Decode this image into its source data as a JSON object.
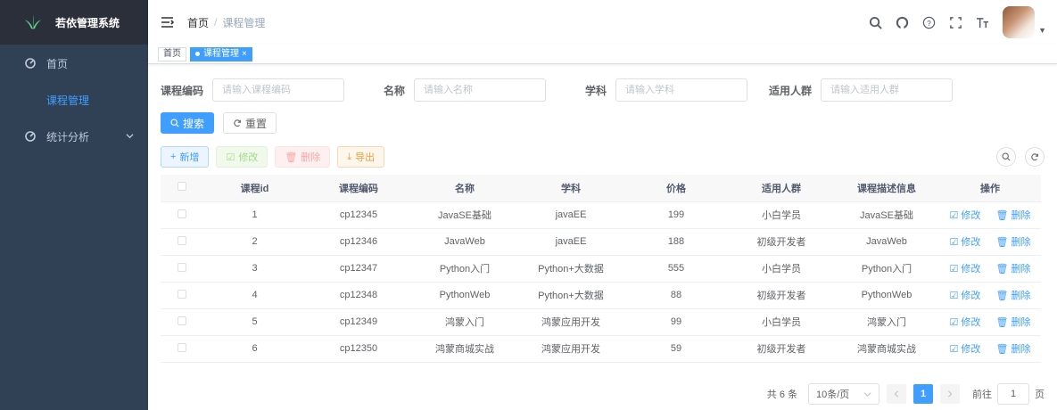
{
  "app": {
    "title": "若依管理系统"
  },
  "colors": {
    "sidebar_bg": "#304156",
    "primary": "#409eff",
    "active_menu": "#409eff"
  },
  "sidebar": {
    "items": [
      {
        "label": "首页",
        "icon": "dashboard-icon"
      },
      {
        "label": "课程管理",
        "active": true
      },
      {
        "label": "统计分析",
        "icon": "dashboard-icon",
        "expandable": true
      }
    ]
  },
  "navbar": {
    "breadcrumb": {
      "home": "首页",
      "separator": "/",
      "current": "课程管理"
    },
    "icons": [
      "search-icon",
      "github-icon",
      "question-icon",
      "fullscreen-icon",
      "font-size-icon"
    ]
  },
  "tags": [
    {
      "label": "首页",
      "active": false
    },
    {
      "label": "课程管理",
      "active": true,
      "close": "×"
    }
  ],
  "search": {
    "code_label": "课程编码",
    "code_placeholder": "请输入课程编码",
    "name_label": "名称",
    "name_placeholder": "请输入名称",
    "subject_label": "学科",
    "subject_placeholder": "请输入学科",
    "crowd_label": "适用人群",
    "crowd_placeholder": "请输入适用人群",
    "search_btn": "搜索",
    "reset_btn": "重置"
  },
  "toolbar": {
    "add": "新增",
    "edit": "修改",
    "delete": "删除",
    "export": "导出"
  },
  "table": {
    "headers": [
      "课程id",
      "课程编码",
      "名称",
      "学科",
      "价格",
      "适用人群",
      "课程描述信息",
      "操作"
    ],
    "rows": [
      {
        "id": "1",
        "code": "cp12345",
        "name": "JavaSE基础",
        "subject": "javaEE",
        "price": "199",
        "crowd": "小白学员",
        "desc": "JavaSE基础",
        "edit": "修改",
        "del": "删除"
      },
      {
        "id": "2",
        "code": "cp12346",
        "name": "JavaWeb",
        "subject": "javaEE",
        "price": "188",
        "crowd": "初级开发者",
        "desc": "JavaWeb",
        "edit": "修改",
        "del": "删除"
      },
      {
        "id": "3",
        "code": "cp12347",
        "name": "Python入门",
        "subject": "Python+大数据",
        "price": "555",
        "crowd": "小白学员",
        "desc": "Python入门",
        "edit": "修改",
        "del": "删除"
      },
      {
        "id": "4",
        "code": "cp12348",
        "name": "PythonWeb",
        "subject": "Python+大数据",
        "price": "88",
        "crowd": "初级开发者",
        "desc": "PythonWeb",
        "edit": "修改",
        "del": "删除"
      },
      {
        "id": "5",
        "code": "cp12349",
        "name": "鸿蒙入门",
        "subject": "鸿蒙应用开发",
        "price": "99",
        "crowd": "小白学员",
        "desc": "鸿蒙入门",
        "edit": "修改",
        "del": "删除"
      },
      {
        "id": "6",
        "code": "cp12350",
        "name": "鸿蒙商城实战",
        "subject": "鸿蒙应用开发",
        "price": "59",
        "crowd": "初级开发者",
        "desc": "鸿蒙商城实战",
        "edit": "修改",
        "del": "删除"
      }
    ]
  },
  "pagination": {
    "total": "共 6 条",
    "page_size": "10条/页",
    "current_page": "1",
    "goto_label": "前往",
    "goto_value": "1",
    "page_suffix": "页"
  }
}
